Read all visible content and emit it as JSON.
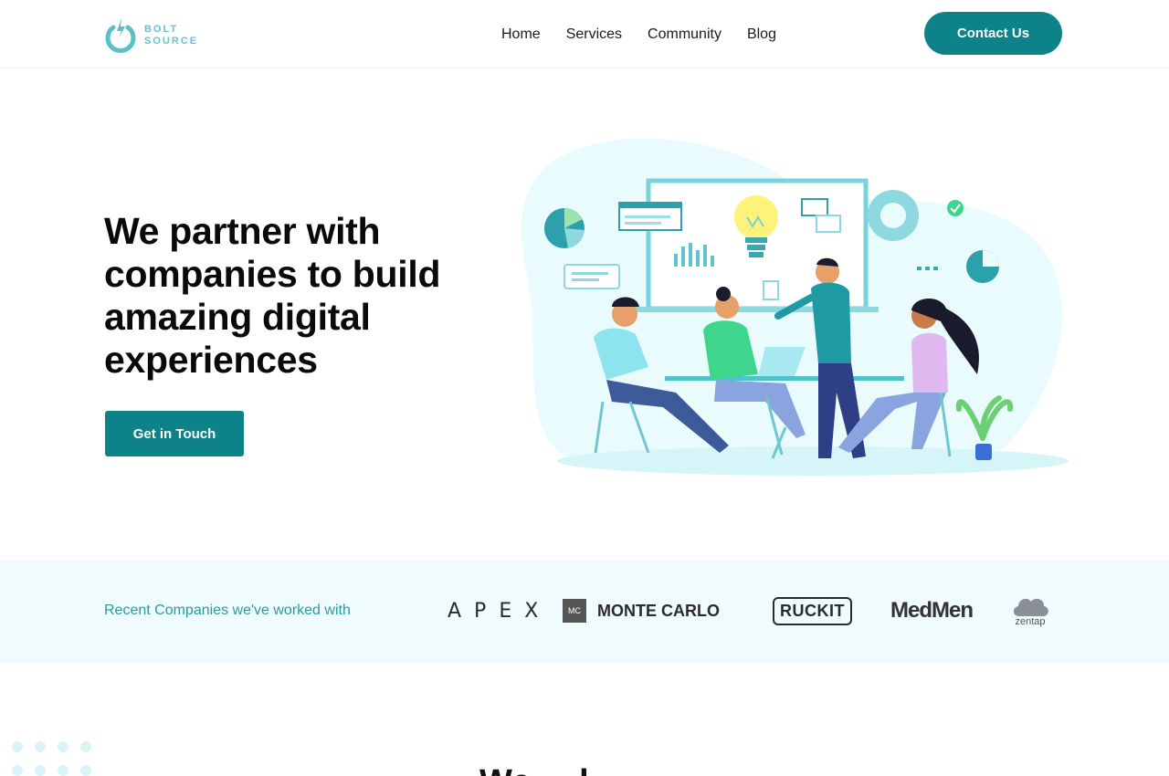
{
  "brand": {
    "line1": "BOLT",
    "line2": "SOURCE",
    "color": "#67c3cc"
  },
  "nav": [
    {
      "label": "Home"
    },
    {
      "label": "Services"
    },
    {
      "label": "Community"
    },
    {
      "label": "Blog"
    }
  ],
  "header": {
    "contact_label": "Contact Us"
  },
  "hero": {
    "title": "We partner with companies to build amazing digital experiences",
    "cta_label": "Get in Touch"
  },
  "clients": {
    "label": "Recent Companies we've worked with",
    "logos": [
      {
        "name": "APEX"
      },
      {
        "name": "MONTE CARLO",
        "badge": "MC"
      },
      {
        "name": "RUCKIT"
      },
      {
        "name": "MedMen"
      },
      {
        "name": "zentap"
      }
    ]
  },
  "next_section": {
    "heading_fragment": "We  ... l"
  },
  "colors": {
    "accent": "#0e8289",
    "accent_light": "#67c3cc",
    "strip_bg": "#effbfc"
  }
}
